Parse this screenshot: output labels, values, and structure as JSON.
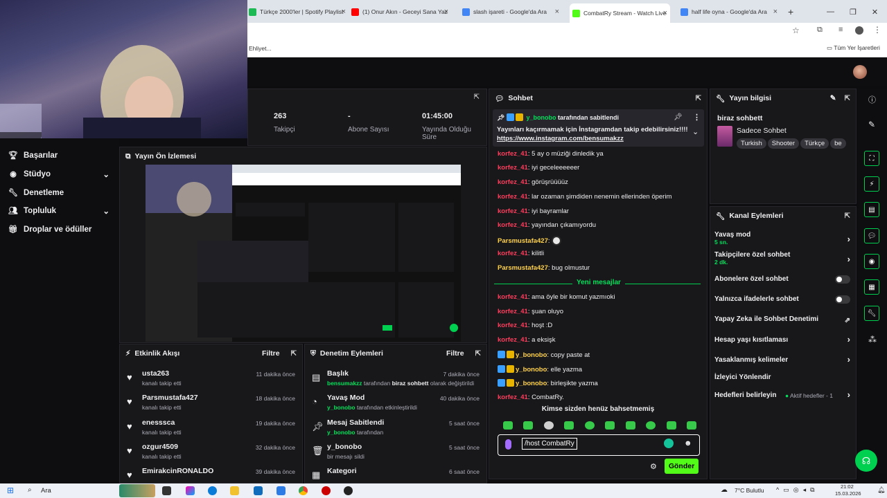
{
  "browser": {
    "tabs": [
      {
        "title": "Türkçe 2000'ler | Spotify Playlist",
        "color": "#1db954"
      },
      {
        "title": "(1) Onur Akın - Geceyi Sana Yaz",
        "color": "#ff0000"
      },
      {
        "title": "slash işareti - Google'da Ara",
        "color": "#4285f4"
      },
      {
        "title": "CombatRy Stream - Watch Live",
        "color": "#53fc18"
      },
      {
        "title": "half life oyna - Google'da Ara",
        "color": "#4285f4"
      }
    ],
    "new_tab": "+",
    "bookmark_left": "Ehliyet...",
    "bookmark_right": "Tüm Yer İşaretleri"
  },
  "sidebar": {
    "items": [
      {
        "label": "Başarılar",
        "icon": "trophy-icon",
        "chev": ""
      },
      {
        "label": "Stüdyo",
        "icon": "studio-icon",
        "chev": "⌄"
      },
      {
        "label": "Denetleme",
        "icon": "wrench-icon",
        "chev": ""
      },
      {
        "label": "Topluluk",
        "icon": "community-icon",
        "chev": "⌄"
      },
      {
        "label": "Droplar ve ödüller",
        "icon": "gift-icon",
        "chev": ""
      }
    ]
  },
  "stats": [
    {
      "value": "263",
      "label": "Takipçi"
    },
    {
      "value": "-",
      "label": "Abone Sayısı"
    },
    {
      "value": "01:45:00",
      "label": "Yayında Olduğu Süre"
    }
  ],
  "preview": {
    "title": "Yayın Ön İzlemesi"
  },
  "activity": {
    "title": "Etkinlik Akışı",
    "filter": "Filtre",
    "items": [
      {
        "user": "usta263",
        "desc": "kanalı takip etti",
        "time": "11 dakika önce"
      },
      {
        "user": "Parsmustafa427",
        "desc": "kanalı takip etti",
        "time": "18 dakika önce"
      },
      {
        "user": "enesssca",
        "desc": "kanalı takip etti",
        "time": "19 dakika önce"
      },
      {
        "user": "ozgur4509",
        "desc": "kanalı takip etti",
        "time": "32 dakika önce"
      },
      {
        "user": "EmirakcinRONALDO",
        "desc": "",
        "time": "39 dakika önce"
      }
    ]
  },
  "moderation": {
    "title": "Denetim Eylemleri",
    "filter": "Filtre",
    "items": [
      {
        "title": "Başlık",
        "icon": "title-icon",
        "user": "bensumakzz",
        "pre": " tarafından ",
        "bold": "biraz sohbett",
        "post": " olarak değiştirildi",
        "time": "7 dakika önce"
      },
      {
        "title": "Yavaş Mod",
        "icon": "slow-mode-icon",
        "user": "y_bonobo",
        "pre": " tarafından etkinleştirildi",
        "bold": "",
        "post": "",
        "time": "40 dakika önce"
      },
      {
        "title": "Mesaj Sabitlendi",
        "icon": "pin-icon",
        "user": "y_bonobo",
        "pre": " tarafından",
        "bold": "",
        "post": "",
        "time": "5 saat önce"
      },
      {
        "title": "y_bonobo",
        "icon": "trash-icon",
        "user": "",
        "pre": "bir mesajı sildi",
        "bold": "",
        "post": "",
        "time": "5 saat önce"
      },
      {
        "title": "Kategori",
        "icon": "category-icon",
        "user": "",
        "pre": "",
        "bold": "",
        "post": "",
        "time": "6 saat önce"
      }
    ]
  },
  "chat": {
    "title": "Sohbet",
    "pinned_by_user": "y_bonobo",
    "pinned_by_suffix": " tarafından sabitlendi",
    "pinned_text": "Yayınları kaçırmamak için İnstagramdan takip edebilirsiniz!!!! ",
    "pinned_link": "https://www.instagram.com/bensumakzz",
    "messages": [
      {
        "user": "korfez_41",
        "text": "5 ay o müziği dinledik ya",
        "color": "red",
        "badges": false
      },
      {
        "user": "korfez_41",
        "text": "iyi geceleeeeeer",
        "color": "red",
        "badges": false
      },
      {
        "user": "korfez_41",
        "text": "görüşrüüüüz",
        "color": "red",
        "badges": false
      },
      {
        "user": "korfez_41",
        "text": "lar ozaman şimdiden nenemin ellerinden öperim",
        "color": "red",
        "badges": false
      },
      {
        "user": "korfez_41",
        "text": "iyi bayramlar",
        "color": "red",
        "badges": false
      },
      {
        "user": "korfez_41",
        "text": "yayından çıkamıyordu",
        "color": "red",
        "badges": false
      },
      {
        "user": "Parsmustafa427",
        "text": "",
        "color": "gold",
        "badges": false,
        "emote": true
      },
      {
        "user": "korfez_41",
        "text": "kilitli",
        "color": "red",
        "badges": false
      },
      {
        "user": "Parsmustafa427",
        "text": "bug olmustur",
        "color": "gold",
        "badges": false
      }
    ],
    "new_messages": "Yeni mesajlar",
    "messages2": [
      {
        "user": "korfez_41",
        "text": "ama öyle bir komut yazmıoki",
        "color": "red",
        "badges": false
      },
      {
        "user": "korfez_41",
        "text": "şuan oluyo",
        "color": "red",
        "badges": false
      },
      {
        "user": "korfez_41",
        "text": "hoşt :D",
        "color": "red",
        "badges": false
      },
      {
        "user": "korfez_41",
        "text": "a eksişk",
        "color": "red",
        "badges": false
      },
      {
        "user": "y_bonobo",
        "text": "copy paste at",
        "color": "gold",
        "badges": true
      },
      {
        "user": "y_bonobo",
        "text": "elle yazma",
        "color": "gold",
        "badges": true
      },
      {
        "user": "y_bonobo",
        "text": "birleşikte yazma",
        "color": "gold",
        "badges": true
      },
      {
        "user": "korfez_41",
        "text": "CombatRy.",
        "color": "red",
        "badges": false
      }
    ],
    "mentions": "Kimse sizden henüz bahsetmemiş",
    "input_value": "/host CombatRy",
    "send": "Gönder"
  },
  "stream_info": {
    "title": "Yayın bilgisi",
    "stream_title": "biraz sohbett",
    "category": "Sadece Sohbet",
    "tags": [
      "Turkish",
      "Shooter",
      "Türkçe",
      "be"
    ]
  },
  "channel_actions": {
    "title": "Kanal Eylemleri",
    "items": [
      {
        "label": "Yavaş mod",
        "sub": "5 sn.",
        "control": "arrow"
      },
      {
        "label": "Takipçilere özel sohbet",
        "sub": "2 dk.",
        "control": "arrow"
      },
      {
        "label": "Abonelere özel sohbet",
        "sub": "",
        "control": "toggle"
      },
      {
        "label": "Yalnızca ifadelerle sohbet",
        "sub": "",
        "control": "toggle"
      },
      {
        "label": "Yapay Zeka ile Sohbet Denetimi",
        "sub": "",
        "control": "external"
      },
      {
        "label": "Hesap yaşı kısıtlaması",
        "sub": "",
        "control": "arrow"
      },
      {
        "label": "Yasaklanmış kelimeler",
        "sub": "",
        "control": "arrow"
      },
      {
        "label": "İzleyici Yönlendir",
        "sub": "",
        "control": "none"
      },
      {
        "label": "Hedefleri belirleyin",
        "sub": "",
        "control": "goals"
      }
    ],
    "goals_status": "Aktif hedefler - 1"
  },
  "taskbar": {
    "search": "Ara",
    "weather": "7°C  Bulutlu",
    "time": "21:02",
    "date": "15.03.2026"
  },
  "colors": {
    "accent": "#53fc18",
    "bg": "#0e0e10",
    "panel": "#18181b"
  }
}
